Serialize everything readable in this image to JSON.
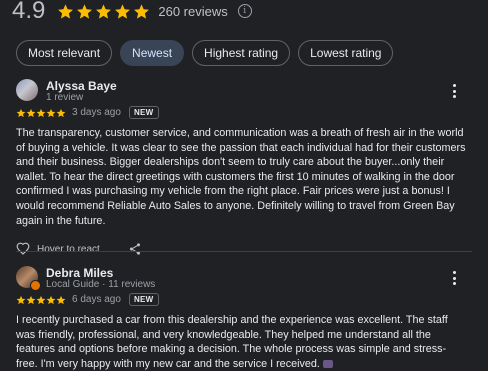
{
  "summary": {
    "rating": "4.9",
    "stars": 5,
    "count_label": "260 reviews",
    "info_glyph": "i"
  },
  "sort_chips": [
    {
      "label": "Most relevant",
      "active": false
    },
    {
      "label": "Newest",
      "active": true
    },
    {
      "label": "Highest rating",
      "active": false
    },
    {
      "label": "Lowest rating",
      "active": false
    }
  ],
  "reviews": [
    {
      "name": "Alyssa Baye",
      "subtitle": "1 review",
      "stars": 5,
      "time_ago": "3 days ago",
      "badge": "NEW",
      "text": "The transparency, customer service, and communication was a breath of fresh air in the world of buying a vehicle. It was clear to see the passion that each individual had for their customers and their business. Bigger dealerships don't seem to truly care about the buyer...only their wallet. To hear the direct greetings with customers the first 10 minutes of walking in the door confirmed I was purchasing my vehicle from the right place. Fair prices were just a bonus! I would recommend Reliable Auto Sales to anyone. Definitely willing to travel from Green Bay again in the future.",
      "hover_label": "Hover to react"
    },
    {
      "name": "Debra Miles",
      "subtitle": "Local Guide · 11 reviews",
      "stars": 5,
      "time_ago": "6 days ago",
      "badge": "NEW",
      "text": "I recently purchased a car from this dealership and the experience was excellent. The staff was friendly, professional, and very knowledgeable. They helped me understand all the features and options before making a decision. The whole process was simple and stress-free. I'm very happy with my new car and the service I received."
    }
  ],
  "colors": {
    "star": "#fbbc04",
    "background": "#202124",
    "active_chip": "#394457"
  }
}
